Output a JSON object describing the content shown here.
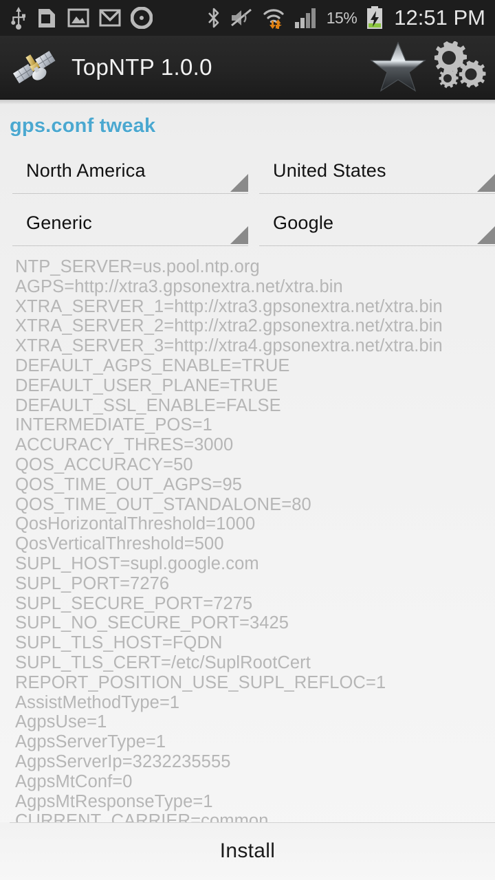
{
  "statusbar": {
    "left_icons": [
      "usb-icon",
      "sd-card-icon",
      "gallery-icon",
      "gmail-icon",
      "recording-icon"
    ],
    "right_icons": [
      "bluetooth-icon",
      "mute-icon",
      "wifi-transfer-icon",
      "signal-bars-icon"
    ],
    "battery_percent": "15%",
    "battery_state": "charging",
    "clock": "12:51 PM"
  },
  "actionbar": {
    "app_icon": "satellite-icon",
    "title": "TopNTP 1.0.0",
    "star_label": "star-icon",
    "settings_label": "gears-icon"
  },
  "main": {
    "section_title": "gps.conf tweak",
    "spinners": [
      {
        "name": "continent",
        "value": "North America"
      },
      {
        "name": "country",
        "value": "United States"
      },
      {
        "name": "device",
        "value": "Generic"
      },
      {
        "name": "provider",
        "value": "Google"
      }
    ],
    "config_lines": [
      "NTP_SERVER=us.pool.ntp.org",
      "AGPS=http://xtra3.gpsonextra.net/xtra.bin",
      "XTRA_SERVER_1=http://xtra3.gpsonextra.net/xtra.bin",
      "XTRA_SERVER_2=http://xtra2.gpsonextra.net/xtra.bin",
      "XTRA_SERVER_3=http://xtra4.gpsonextra.net/xtra.bin",
      "DEFAULT_AGPS_ENABLE=TRUE",
      "DEFAULT_USER_PLANE=TRUE",
      "DEFAULT_SSL_ENABLE=FALSE",
      "INTERMEDIATE_POS=1",
      "ACCURACY_THRES=3000",
      "QOS_ACCURACY=50",
      "QOS_TIME_OUT_AGPS=95",
      "QOS_TIME_OUT_STANDALONE=80",
      "QosHorizontalThreshold=1000",
      "QosVerticalThreshold=500",
      "SUPL_HOST=supl.google.com",
      "SUPL_PORT=7276",
      "SUPL_SECURE_PORT=7275",
      "SUPL_NO_SECURE_PORT=3425",
      "SUPL_TLS_HOST=FQDN",
      "SUPL_TLS_CERT=/etc/SuplRootCert",
      "REPORT_POSITION_USE_SUPL_REFLOC=1",
      "AssistMethodType=1",
      "AgpsUse=1",
      "AgpsServerType=1",
      "AgpsServerIp=3232235555",
      "AgpsMtConf=0",
      "AgpsMtResponseType=1",
      "CURRENT_CARRIER=common"
    ]
  },
  "footer": {
    "install_label": "Install"
  },
  "colors": {
    "accent_blue": "#4ba8d0",
    "statusbar_bg": "#1d1d1d",
    "actionbar_bg": "#242424",
    "content_bg": "#f1f1f1",
    "config_text": "#b6b6b6",
    "battery_green": "#8cc63f"
  }
}
